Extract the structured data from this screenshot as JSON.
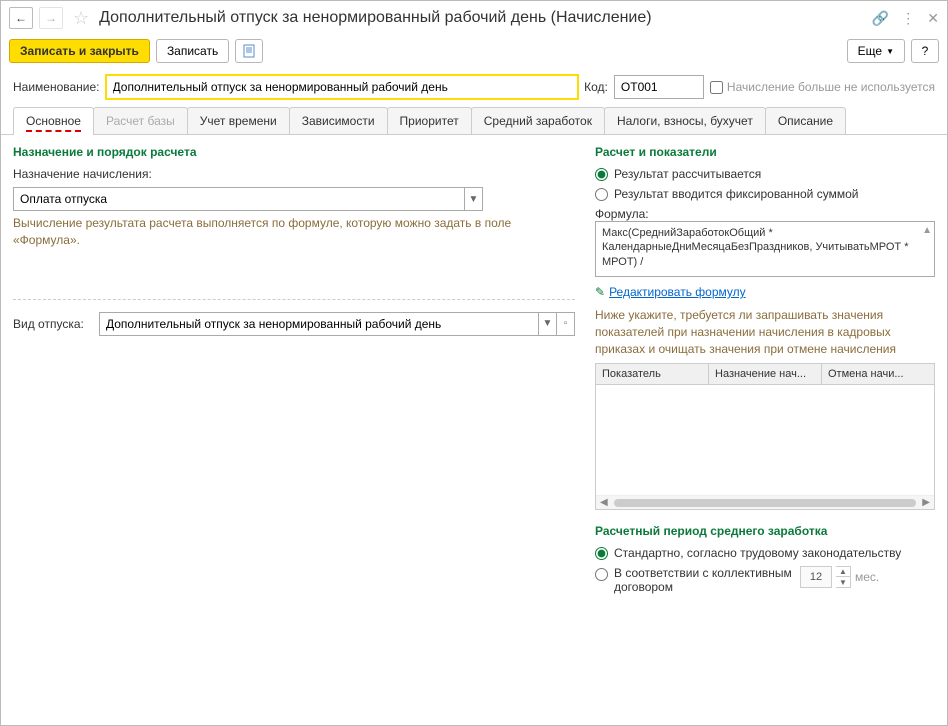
{
  "title": "Дополнительный отпуск за ненормированный рабочий день (Начисление)",
  "toolbar": {
    "save_close": "Записать и закрыть",
    "save": "Записать",
    "more": "Еще",
    "help": "?"
  },
  "form": {
    "name_label": "Наименование:",
    "name_value": "Дополнительный отпуск за ненормированный рабочий день",
    "code_label": "Код:",
    "code_value": "ОТ001",
    "inactive_label": "Начисление больше не используется"
  },
  "tabs": [
    "Основное",
    "Расчет базы",
    "Учет времени",
    "Зависимости",
    "Приоритет",
    "Средний заработок",
    "Налоги, взносы, бухучет",
    "Описание"
  ],
  "left": {
    "section1": "Назначение и порядок расчета",
    "purpose_label": "Назначение начисления:",
    "purpose_value": "Оплата отпуска",
    "hint": "Вычисление результата расчета выполняется по формуле, которую можно задать в поле «Формула».",
    "vacation_type_label": "Вид отпуска:",
    "vacation_type_value": "Дополнительный отпуск за ненормированный рабочий день"
  },
  "right": {
    "section1": "Расчет и показатели",
    "radio1": "Результат рассчитывается",
    "radio2": "Результат вводится фиксированной суммой",
    "formula_label": "Формула:",
    "formula_text": "Макс(СреднийЗаработокОбщий * КалендарныеДниМесяцаБезПраздников, УчитыватьМРОТ * МРОТ) /",
    "edit_formula": "Редактировать формулу",
    "hint2": "Ниже укажите, требуется ли запрашивать значения показателей при назначении начисления в кадровых приказах и очищать значения при отмене начисления",
    "th1": "Показатель",
    "th2": "Назначение нач...",
    "th3": "Отмена начи...",
    "section2": "Расчетный период среднего заработка",
    "radio3": "Стандартно, согласно трудовому законодательству",
    "radio4": "В соответствии с коллективным договором",
    "spinner_value": "12",
    "mes": "мес."
  }
}
